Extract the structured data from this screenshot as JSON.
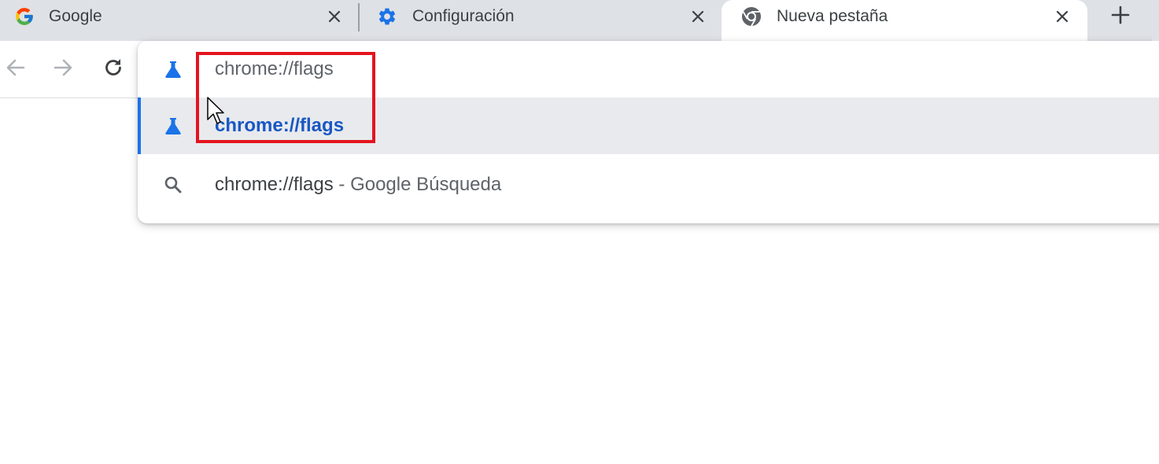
{
  "tabs": [
    {
      "title": "Google",
      "favicon": "google-g-icon",
      "active": false
    },
    {
      "title": "Configuración",
      "favicon": "gear-icon",
      "active": false
    },
    {
      "title": "Nueva pestaña",
      "favicon": "chrome-icon",
      "active": true
    }
  ],
  "new_tab_label": "+",
  "omnibox": {
    "input_text": "chrome://flags",
    "suggestions": [
      {
        "text": "chrome://flags",
        "icon": "flask-icon",
        "selected": true
      },
      {
        "text": "chrome://flags",
        "suffix": "Google Búsqueda",
        "separator": " - ",
        "icon": "search-icon",
        "selected": false
      }
    ]
  },
  "colors": {
    "accent": "#1a73e8",
    "highlight_box": "#e3141e",
    "tabstrip_bg": "#dee1e6",
    "selected_row_bg": "#e8eaed"
  }
}
